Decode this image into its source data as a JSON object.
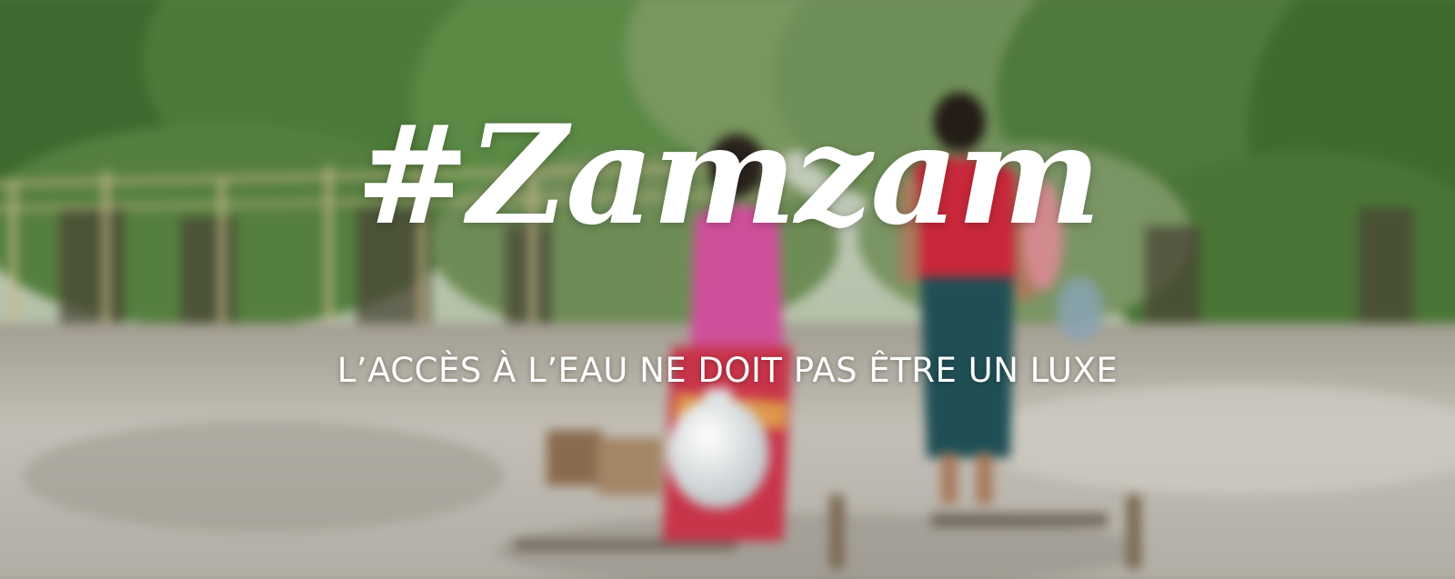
{
  "banner": {
    "title": "#Zamzam",
    "subtitle": "L’ACCÈS À L’EAU NE DOIT PAS ÊTRE UN LUXE"
  },
  "colors": {
    "text": "#ffffff",
    "foliage": "#3f6b2e",
    "ground": "#b9b5ad",
    "shirt_red": "#c8283a",
    "dress_pink": "#d04f9a",
    "sarong_teal": "#1f4f55",
    "pot_white": "#eef0f0"
  }
}
